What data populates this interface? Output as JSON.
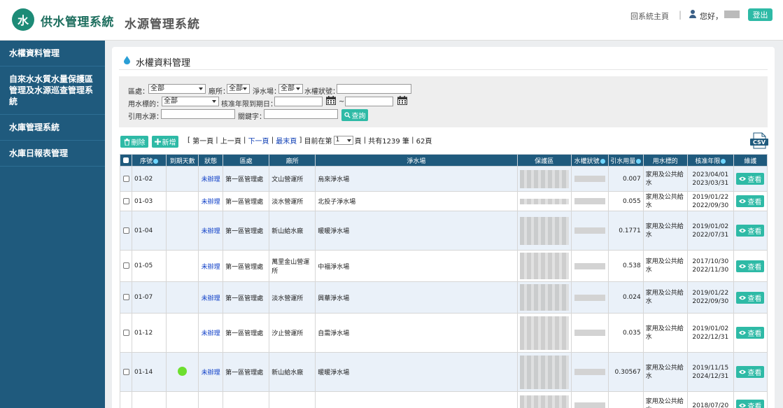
{
  "header": {
    "logo_text": "水",
    "system_title": "供水管理系統",
    "sub_title": "水源管理系統",
    "home_link": "回系統主頁",
    "separator": "|",
    "greeting": "您好，",
    "logout": "登出"
  },
  "sidebar": {
    "items": [
      {
        "label": "水權資料管理"
      },
      {
        "label": "自來水水質水量保護區管理及水源巡查管理系統"
      },
      {
        "label": "水庫管理系統"
      },
      {
        "label": "水庫日報表管理"
      }
    ]
  },
  "page": {
    "title": "水權資料管理"
  },
  "filters": {
    "region_label": "區處：",
    "region_value": "全部",
    "plant_label": "廠所：",
    "plant_value": "全部",
    "purif_label": "淨水場：",
    "purif_value": "全部",
    "status_label": "水權狀號：",
    "usage_label": "用水標的：",
    "usage_value": "全部",
    "expiry_label": "核准年限到期日：",
    "range_sep": "~",
    "source_label": "引用水源：",
    "keyword_label": "關鍵字：",
    "search_button": "查詢"
  },
  "actions": {
    "delete_button": "刪除",
    "add_button": "新增"
  },
  "pager": {
    "first": "第一頁",
    "prev": "上一頁",
    "next": "下一頁",
    "last": "最末頁",
    "current_prefix": "目前在第",
    "current_page": "1",
    "current_suffix": "頁",
    "total": "共有1239 筆",
    "pages": "62頁",
    "csv": "CSV"
  },
  "table": {
    "headers": [
      "",
      "序號",
      "到期天數",
      "狀態",
      "區處",
      "廠所",
      "淨水場",
      "保護區",
      "水權狀號",
      "引水用量",
      "用水標的",
      "核准年限",
      "維護"
    ],
    "view_label": "查看",
    "rows": [
      {
        "seq": "01-02",
        "dot": false,
        "status": "未辦理",
        "region": "第一區管理處",
        "plant": "文山營運所",
        "purif": "烏來淨水場",
        "usage_amt": "0.007",
        "use": "家用及公共給水",
        "date1": "2023/04/01",
        "date2": "2023/03/31"
      },
      {
        "seq": "01-03",
        "dot": false,
        "status": "未辦理",
        "region": "第一區管理處",
        "plant": "淡水營運所",
        "purif": "北投子淨水場",
        "usage_amt": "0.055",
        "use": "家用及公共給水",
        "date1": "2019/01/22",
        "date2": "2022/09/30"
      },
      {
        "seq": "01-04",
        "dot": false,
        "status": "未辦理",
        "region": "第一區管理處",
        "plant": "新山給水廠",
        "purif": "暖暖淨水場",
        "usage_amt": "0.1771",
        "use": "家用及公共給水",
        "date1": "2019/01/02",
        "date2": "2022/07/31"
      },
      {
        "seq": "01-05",
        "dot": false,
        "status": "未辦理",
        "region": "第一區管理處",
        "plant": "萬里金山營運所",
        "purif": "中福淨水場",
        "usage_amt": "0.538",
        "use": "家用及公共給水",
        "date1": "2017/10/30",
        "date2": "2022/11/30"
      },
      {
        "seq": "01-07",
        "dot": false,
        "status": "未辦理",
        "region": "第一區管理處",
        "plant": "淡水營運所",
        "purif": "興華淨水場",
        "usage_amt": "0.024",
        "use": "家用及公共給水",
        "date1": "2019/01/22",
        "date2": "2022/09/30"
      },
      {
        "seq": "01-12",
        "dot": false,
        "status": "未辦理",
        "region": "第一區管理處",
        "plant": "汐止營運所",
        "purif": "自需淨水場",
        "usage_amt": "0.035",
        "use": "家用及公共給水",
        "date1": "2019/01/02",
        "date2": "2022/12/31"
      },
      {
        "seq": "01-14",
        "dot": true,
        "status": "未辦理",
        "region": "第一區管理處",
        "plant": "新山給水廠",
        "purif": "暖暖淨水場",
        "usage_amt": "0.30567",
        "use": "家用及公共給水",
        "date1": "2019/11/15",
        "date2": "2024/12/31"
      },
      {
        "seq": "",
        "dot": false,
        "status": "",
        "region": "",
        "plant": "",
        "purif": "",
        "usage_amt": "",
        "use": "家用及公共給水",
        "date1": "2018/07/20",
        "date2": ""
      }
    ]
  },
  "colors": {
    "sidebar": "#1f5a7d",
    "accent": "#2ebaa6",
    "table_header": "#1f5a7d",
    "link": "#1040c8"
  }
}
